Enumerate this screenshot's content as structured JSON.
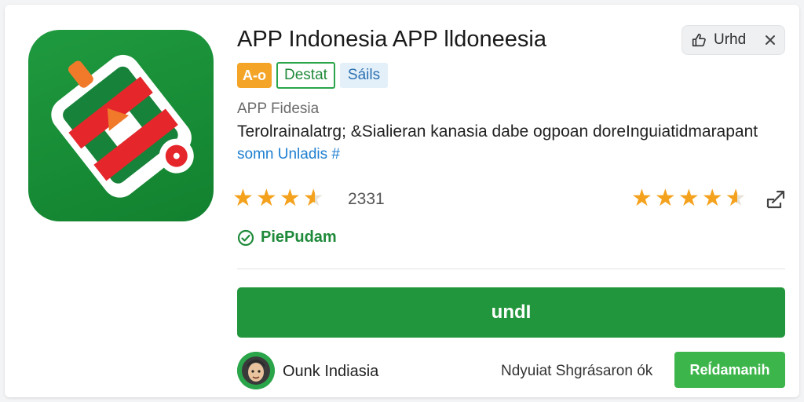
{
  "app": {
    "title": "APP Indonesia APP lldoneesia",
    "developer": "APP Fidesia",
    "description": "Terolrainalatrg; &Sialieran kanasia dabe ogpoan doreInguiatidmarapant",
    "more_link": "somn Unladis #"
  },
  "header_chip": {
    "label": "Urhd",
    "close_icon": "close-icon",
    "thumb_icon": "thumb-up-icon"
  },
  "badges": {
    "age": "A-o",
    "tag_green": "Destat",
    "tag_blue": "Sáils"
  },
  "rating": {
    "stars_left": 3.5,
    "count": "2331",
    "stars_right": 4.5
  },
  "verified": {
    "label": "PiePudam",
    "icon": "check-circle-icon"
  },
  "install_button": {
    "label": "undI"
  },
  "publisher": {
    "name": "Ounk Indiasia",
    "sponsor_text": "Ndyuiat Shgrásaron ók",
    "open_label": "ReÍdamanih"
  },
  "colors": {
    "primary_green": "#22963c",
    "star": "#f4a21d",
    "link_blue": "#1e7fd0"
  }
}
